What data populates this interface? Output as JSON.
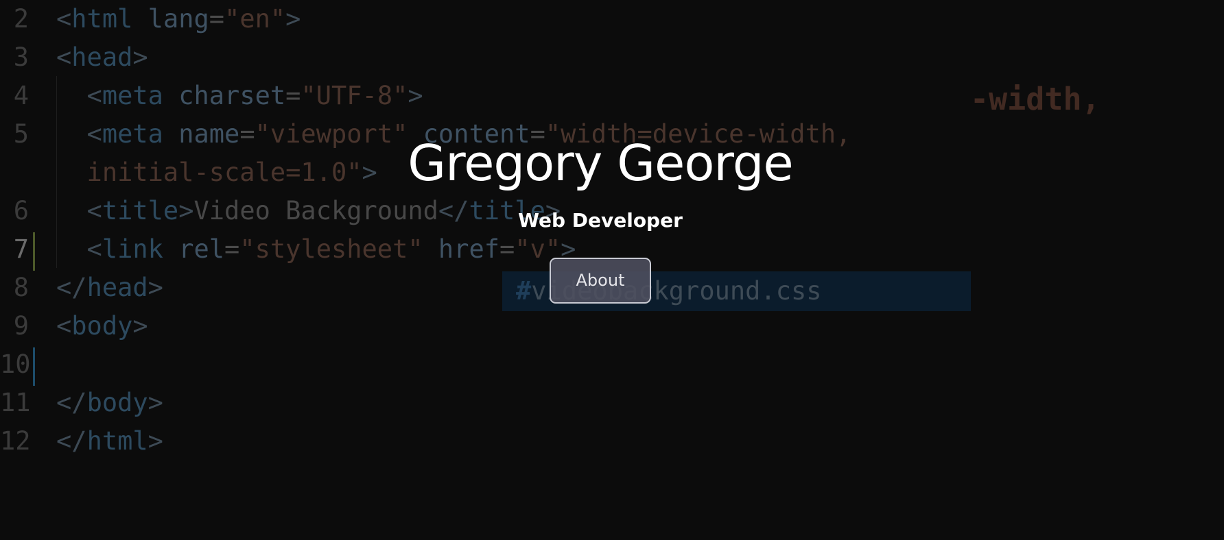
{
  "hero": {
    "name": "Gregory George",
    "role": "Web Developer",
    "about_label": "About"
  },
  "background_code": {
    "lines": [
      {
        "number": "2",
        "tokens": [
          [
            "t-br",
            "<"
          ],
          [
            "t-tag",
            "html"
          ],
          [
            "t-attr",
            " lang"
          ],
          [
            "t-eq",
            "="
          ],
          [
            "t-str",
            "\"en\""
          ],
          [
            "t-br",
            ">"
          ]
        ]
      },
      {
        "number": "3",
        "tokens": [
          [
            "t-br",
            "<"
          ],
          [
            "t-tag",
            "head"
          ],
          [
            "t-br",
            ">"
          ]
        ]
      },
      {
        "number": "4",
        "tokens": [
          [
            "t-br",
            "  <"
          ],
          [
            "t-tag",
            "meta"
          ],
          [
            "t-attr",
            " charset"
          ],
          [
            "t-eq",
            "="
          ],
          [
            "t-str",
            "\"UTF-8\""
          ],
          [
            "t-br",
            ">"
          ]
        ]
      },
      {
        "number": "5",
        "tokens": [
          [
            "t-br",
            "  <"
          ],
          [
            "t-tag",
            "meta"
          ],
          [
            "t-attr",
            " name"
          ],
          [
            "t-eq",
            "="
          ],
          [
            "t-str",
            "\"viewport\""
          ],
          [
            "t-attr",
            " content"
          ],
          [
            "t-eq",
            "="
          ],
          [
            "t-str",
            "\"width=device-width,"
          ]
        ]
      },
      {
        "number": "",
        "tokens": [
          [
            "t-str",
            "  initial-scale=1.0\""
          ],
          [
            "t-br",
            ">"
          ]
        ]
      },
      {
        "number": "6",
        "tokens": [
          [
            "t-br",
            "  <"
          ],
          [
            "t-tag",
            "title"
          ],
          [
            "t-br",
            ">"
          ],
          [
            "t-text",
            "Video Background"
          ],
          [
            "t-br",
            "</"
          ],
          [
            "t-tag",
            "title"
          ],
          [
            "t-br",
            ">"
          ]
        ]
      },
      {
        "number": "7",
        "tokens": [
          [
            "t-br",
            "  <"
          ],
          [
            "t-tag",
            "link"
          ],
          [
            "t-attr",
            " rel"
          ],
          [
            "t-eq",
            "="
          ],
          [
            "t-str",
            "\"stylesheet\""
          ],
          [
            "t-attr",
            " href"
          ],
          [
            "t-eq",
            "="
          ],
          [
            "t-str",
            "\"v\""
          ],
          [
            "t-br",
            ">"
          ]
        ]
      },
      {
        "number": "8",
        "tokens": [
          [
            "t-br",
            "</"
          ],
          [
            "t-tag",
            "head"
          ],
          [
            "t-br",
            ">"
          ]
        ]
      },
      {
        "number": "9",
        "tokens": [
          [
            "t-br",
            "<"
          ],
          [
            "t-tag",
            "body"
          ],
          [
            "t-br",
            ">"
          ]
        ]
      },
      {
        "number": "10",
        "tokens": []
      },
      {
        "number": "11",
        "tokens": [
          [
            "t-br",
            "</"
          ],
          [
            "t-tag",
            "body"
          ],
          [
            "t-br",
            ">"
          ]
        ]
      },
      {
        "number": "12",
        "tokens": [
          [
            "t-br",
            "</"
          ],
          [
            "t-tag",
            "html"
          ],
          [
            "t-br",
            ">"
          ]
        ]
      }
    ],
    "ghost_fragment": "-width,",
    "suggestion_hash": "#",
    "suggestion_text": "videobackground.css",
    "colors": {
      "line7_marker": "#4d5a2a",
      "line10_marker": "#1d4d6b",
      "editor_background": "#0c0c0c"
    }
  },
  "colors": {
    "hero_text": "#ffffff",
    "button_border": "#c9cbd4",
    "button_fill": "#4e5060"
  }
}
